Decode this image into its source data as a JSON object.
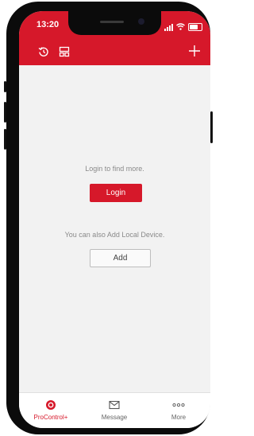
{
  "status_bar": {
    "time": "13:20"
  },
  "colors": {
    "accent": "#d6182a",
    "background": "#f2f2f2",
    "muted_text": "#8a8a8a"
  },
  "header": {
    "icons": [
      "refresh-icon",
      "layout-icon",
      "add-icon"
    ]
  },
  "main": {
    "login_prompt": "Login to find more.",
    "login_label": "Login",
    "local_prompt": "You can also Add Local Device.",
    "add_label": "Add"
  },
  "nav": {
    "items": [
      {
        "label": "ProControl+",
        "icon": "procontrol-icon",
        "active": true
      },
      {
        "label": "Message",
        "icon": "message-icon",
        "active": false
      },
      {
        "label": "More",
        "icon": "more-icon",
        "active": false
      }
    ]
  }
}
